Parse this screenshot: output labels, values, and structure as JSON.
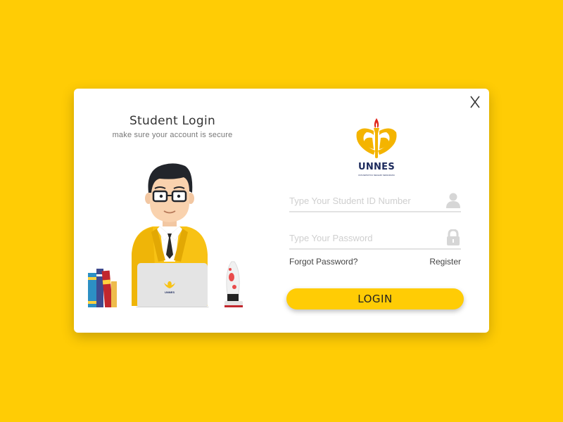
{
  "heading": {
    "title": "Student Login",
    "subtitle": "make sure your account is secure"
  },
  "logo": {
    "name": "UNNES",
    "tagline": "UNIVERSITAS NEGERI SEMARANG"
  },
  "form": {
    "student_id": {
      "placeholder": "Type Your Student ID Number",
      "value": ""
    },
    "password": {
      "placeholder": "Type Your Password",
      "value": ""
    },
    "forgot_label": "Forgot Password?",
    "register_label": "Register",
    "login_label": "LOGIN"
  },
  "close_label": "X",
  "icons": {
    "close": "close-icon",
    "user": "user-icon",
    "lock": "lock-icon"
  },
  "colors": {
    "background": "#FFCC05",
    "card": "#FFFFFF",
    "accent": "#FFCC05",
    "navy": "#1C2A5C"
  }
}
